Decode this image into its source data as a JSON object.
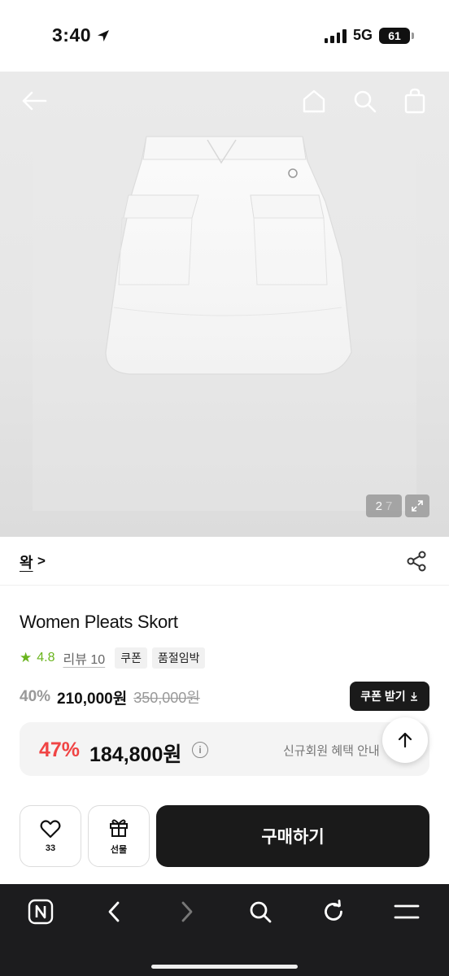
{
  "status": {
    "time": "3:40",
    "network": "5G",
    "battery": "61"
  },
  "gallery": {
    "current": "2",
    "total": "7"
  },
  "brand": {
    "name": "왁",
    "chevron": ">"
  },
  "product": {
    "title": "Women Pleats Skort",
    "rating": "4.8",
    "review_label": "리뷰 10",
    "tags": [
      "쿠폰",
      "품절임박"
    ],
    "discount": "40%",
    "price": "210,000원",
    "original_price": "350,000원",
    "coupon_button": "쿠폰 받기"
  },
  "benefit": {
    "rate": "47%",
    "price": "184,800원",
    "info": "i",
    "note": "신규회원 혜택 안내"
  },
  "actions": {
    "wish_count": "33",
    "gift_label": "선물",
    "buy_label": "구매하기"
  },
  "icons": {
    "nav": [
      "back-arrow-icon",
      "home-icon",
      "search-icon",
      "shopping-bag-icon"
    ],
    "browser": [
      "naver-n-icon",
      "back-icon",
      "forward-icon",
      "search-icon",
      "reload-icon",
      "menu-icon"
    ]
  },
  "colors": {
    "rating_green": "#69b41d",
    "discount_red": "#f04444",
    "dark_button": "#1a1a1a"
  }
}
